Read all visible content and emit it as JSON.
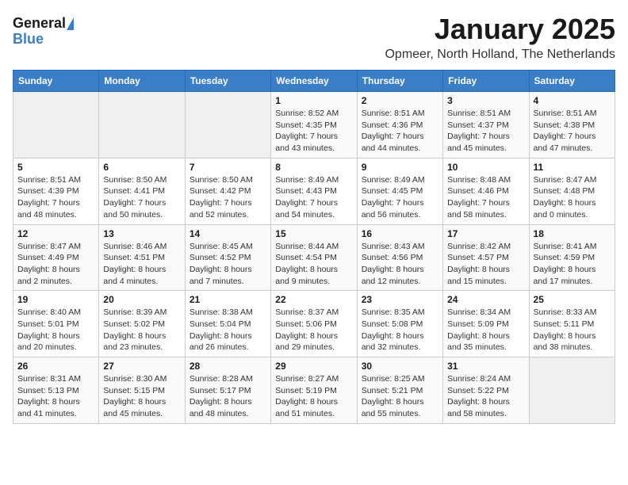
{
  "logo": {
    "general": "General",
    "blue": "Blue"
  },
  "header": {
    "title": "January 2025",
    "location": "Opmeer, North Holland, The Netherlands"
  },
  "weekdays": [
    "Sunday",
    "Monday",
    "Tuesday",
    "Wednesday",
    "Thursday",
    "Friday",
    "Saturday"
  ],
  "weeks": [
    [
      {
        "day": "",
        "info": ""
      },
      {
        "day": "",
        "info": ""
      },
      {
        "day": "",
        "info": ""
      },
      {
        "day": "1",
        "info": "Sunrise: 8:52 AM\nSunset: 4:35 PM\nDaylight: 7 hours\nand 43 minutes."
      },
      {
        "day": "2",
        "info": "Sunrise: 8:51 AM\nSunset: 4:36 PM\nDaylight: 7 hours\nand 44 minutes."
      },
      {
        "day": "3",
        "info": "Sunrise: 8:51 AM\nSunset: 4:37 PM\nDaylight: 7 hours\nand 45 minutes."
      },
      {
        "day": "4",
        "info": "Sunrise: 8:51 AM\nSunset: 4:38 PM\nDaylight: 7 hours\nand 47 minutes."
      }
    ],
    [
      {
        "day": "5",
        "info": "Sunrise: 8:51 AM\nSunset: 4:39 PM\nDaylight: 7 hours\nand 48 minutes."
      },
      {
        "day": "6",
        "info": "Sunrise: 8:50 AM\nSunset: 4:41 PM\nDaylight: 7 hours\nand 50 minutes."
      },
      {
        "day": "7",
        "info": "Sunrise: 8:50 AM\nSunset: 4:42 PM\nDaylight: 7 hours\nand 52 minutes."
      },
      {
        "day": "8",
        "info": "Sunrise: 8:49 AM\nSunset: 4:43 PM\nDaylight: 7 hours\nand 54 minutes."
      },
      {
        "day": "9",
        "info": "Sunrise: 8:49 AM\nSunset: 4:45 PM\nDaylight: 7 hours\nand 56 minutes."
      },
      {
        "day": "10",
        "info": "Sunrise: 8:48 AM\nSunset: 4:46 PM\nDaylight: 7 hours\nand 58 minutes."
      },
      {
        "day": "11",
        "info": "Sunrise: 8:47 AM\nSunset: 4:48 PM\nDaylight: 8 hours\nand 0 minutes."
      }
    ],
    [
      {
        "day": "12",
        "info": "Sunrise: 8:47 AM\nSunset: 4:49 PM\nDaylight: 8 hours\nand 2 minutes."
      },
      {
        "day": "13",
        "info": "Sunrise: 8:46 AM\nSunset: 4:51 PM\nDaylight: 8 hours\nand 4 minutes."
      },
      {
        "day": "14",
        "info": "Sunrise: 8:45 AM\nSunset: 4:52 PM\nDaylight: 8 hours\nand 7 minutes."
      },
      {
        "day": "15",
        "info": "Sunrise: 8:44 AM\nSunset: 4:54 PM\nDaylight: 8 hours\nand 9 minutes."
      },
      {
        "day": "16",
        "info": "Sunrise: 8:43 AM\nSunset: 4:56 PM\nDaylight: 8 hours\nand 12 minutes."
      },
      {
        "day": "17",
        "info": "Sunrise: 8:42 AM\nSunset: 4:57 PM\nDaylight: 8 hours\nand 15 minutes."
      },
      {
        "day": "18",
        "info": "Sunrise: 8:41 AM\nSunset: 4:59 PM\nDaylight: 8 hours\nand 17 minutes."
      }
    ],
    [
      {
        "day": "19",
        "info": "Sunrise: 8:40 AM\nSunset: 5:01 PM\nDaylight: 8 hours\nand 20 minutes."
      },
      {
        "day": "20",
        "info": "Sunrise: 8:39 AM\nSunset: 5:02 PM\nDaylight: 8 hours\nand 23 minutes."
      },
      {
        "day": "21",
        "info": "Sunrise: 8:38 AM\nSunset: 5:04 PM\nDaylight: 8 hours\nand 26 minutes."
      },
      {
        "day": "22",
        "info": "Sunrise: 8:37 AM\nSunset: 5:06 PM\nDaylight: 8 hours\nand 29 minutes."
      },
      {
        "day": "23",
        "info": "Sunrise: 8:35 AM\nSunset: 5:08 PM\nDaylight: 8 hours\nand 32 minutes."
      },
      {
        "day": "24",
        "info": "Sunrise: 8:34 AM\nSunset: 5:09 PM\nDaylight: 8 hours\nand 35 minutes."
      },
      {
        "day": "25",
        "info": "Sunrise: 8:33 AM\nSunset: 5:11 PM\nDaylight: 8 hours\nand 38 minutes."
      }
    ],
    [
      {
        "day": "26",
        "info": "Sunrise: 8:31 AM\nSunset: 5:13 PM\nDaylight: 8 hours\nand 41 minutes."
      },
      {
        "day": "27",
        "info": "Sunrise: 8:30 AM\nSunset: 5:15 PM\nDaylight: 8 hours\nand 45 minutes."
      },
      {
        "day": "28",
        "info": "Sunrise: 8:28 AM\nSunset: 5:17 PM\nDaylight: 8 hours\nand 48 minutes."
      },
      {
        "day": "29",
        "info": "Sunrise: 8:27 AM\nSunset: 5:19 PM\nDaylight: 8 hours\nand 51 minutes."
      },
      {
        "day": "30",
        "info": "Sunrise: 8:25 AM\nSunset: 5:21 PM\nDaylight: 8 hours\nand 55 minutes."
      },
      {
        "day": "31",
        "info": "Sunrise: 8:24 AM\nSunset: 5:22 PM\nDaylight: 8 hours\nand 58 minutes."
      },
      {
        "day": "",
        "info": ""
      }
    ]
  ]
}
